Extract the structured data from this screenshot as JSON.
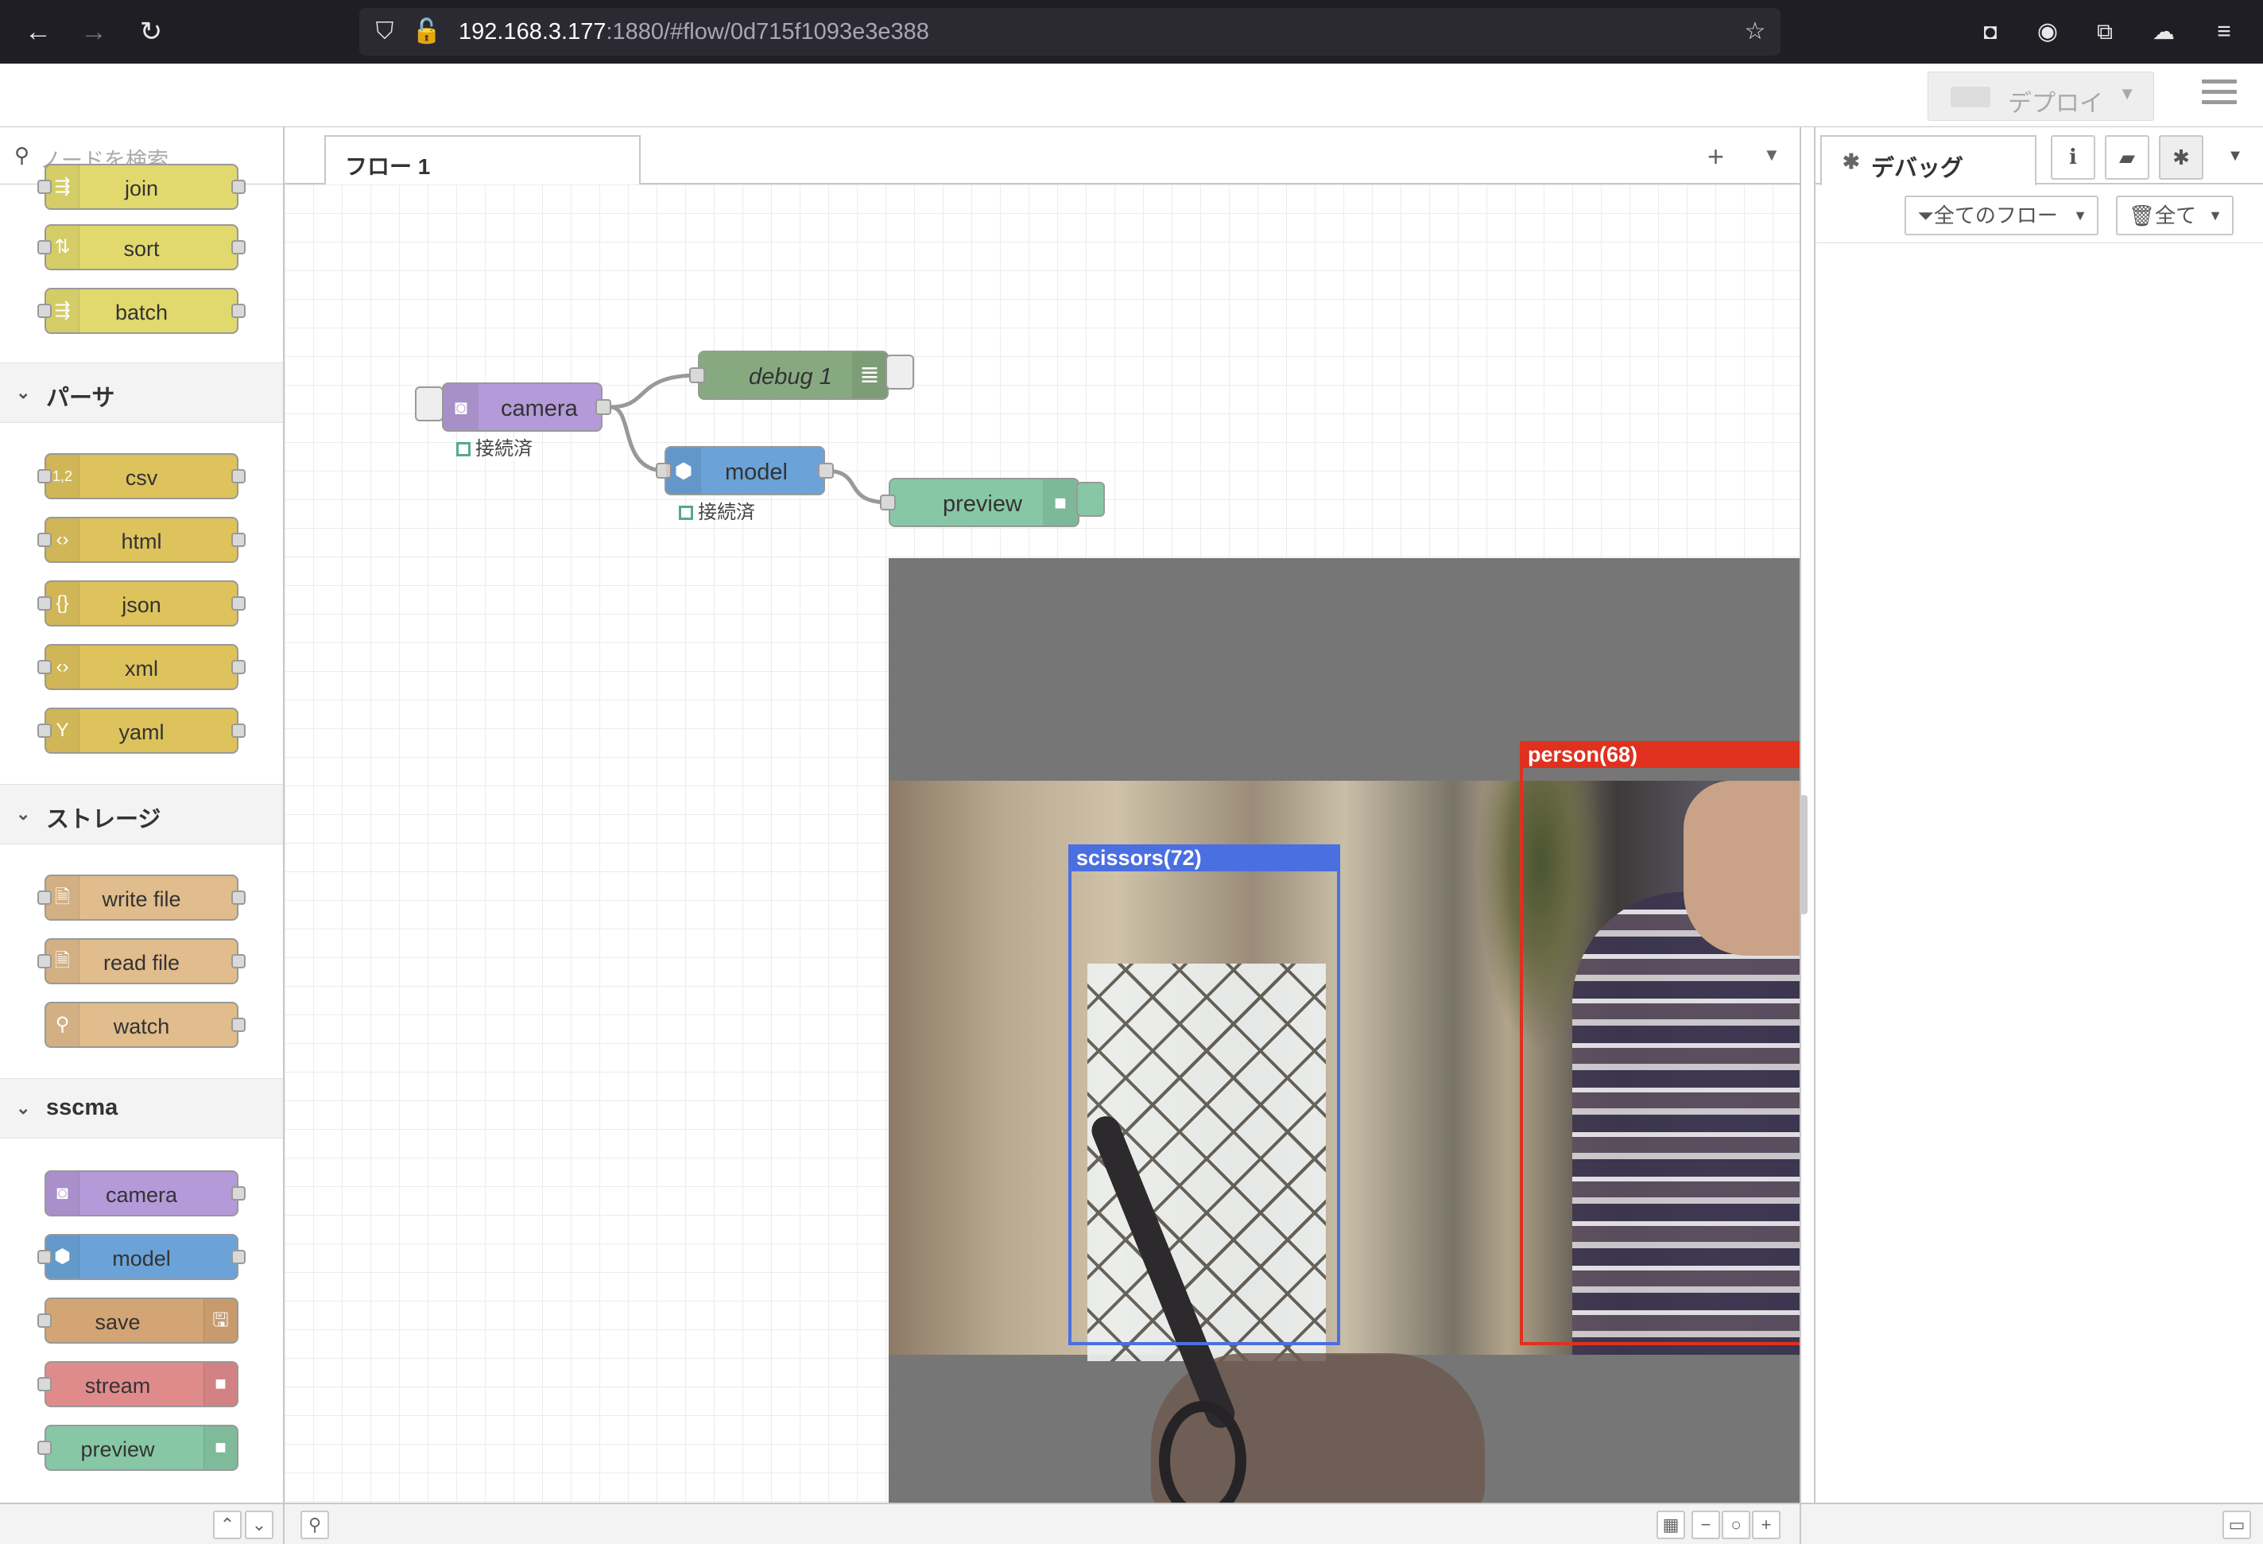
{
  "browser": {
    "url_host": "192.168.3.177",
    "url_rest": ":1880/#flow/0d715f1093e3e388"
  },
  "header": {
    "deploy_label": "デプロイ"
  },
  "palette": {
    "search_placeholder": "ノードを検索",
    "top_nodes": [
      {
        "label": "join"
      },
      {
        "label": "sort"
      },
      {
        "label": "batch"
      }
    ],
    "categories": [
      {
        "title": "パーサ",
        "nodes": [
          "csv",
          "html",
          "json",
          "xml",
          "yaml"
        ]
      },
      {
        "title": "ストレージ",
        "nodes": [
          "write file",
          "read file",
          "watch"
        ]
      },
      {
        "title": "sscma",
        "nodes": [
          "camera",
          "model",
          "save",
          "stream",
          "preview"
        ]
      }
    ],
    "icon_glyphs": {
      "csv": "1,2",
      "html": "‹›",
      "json": "{}",
      "xml": "‹›",
      "yaml": "Y"
    }
  },
  "workspace": {
    "tab_label": "フロー 1",
    "nodes": {
      "camera": "camera",
      "debug": "debug 1",
      "model": "model",
      "preview": "preview"
    },
    "status_text": "接続済",
    "detections": [
      {
        "label": "scissors(72)",
        "color": "#4a6fe0"
      },
      {
        "label": "person(68)",
        "color": "#e0301e"
      }
    ]
  },
  "sidebar": {
    "tab_label": "デバッグ",
    "filter_label": "全てのフロー",
    "clear_label": "全て"
  },
  "colors": {
    "function_yellow": "#e2d96e",
    "parser_yellow": "#dec25c",
    "storage_tan": "#e1bc8c",
    "camera_purple": "#b49ad8",
    "model_blue": "#6ba3d9",
    "save_tan": "#d4a574",
    "stream_red": "#e08b8b",
    "preview_green": "#87c7a5",
    "debug_green": "#87a980"
  }
}
